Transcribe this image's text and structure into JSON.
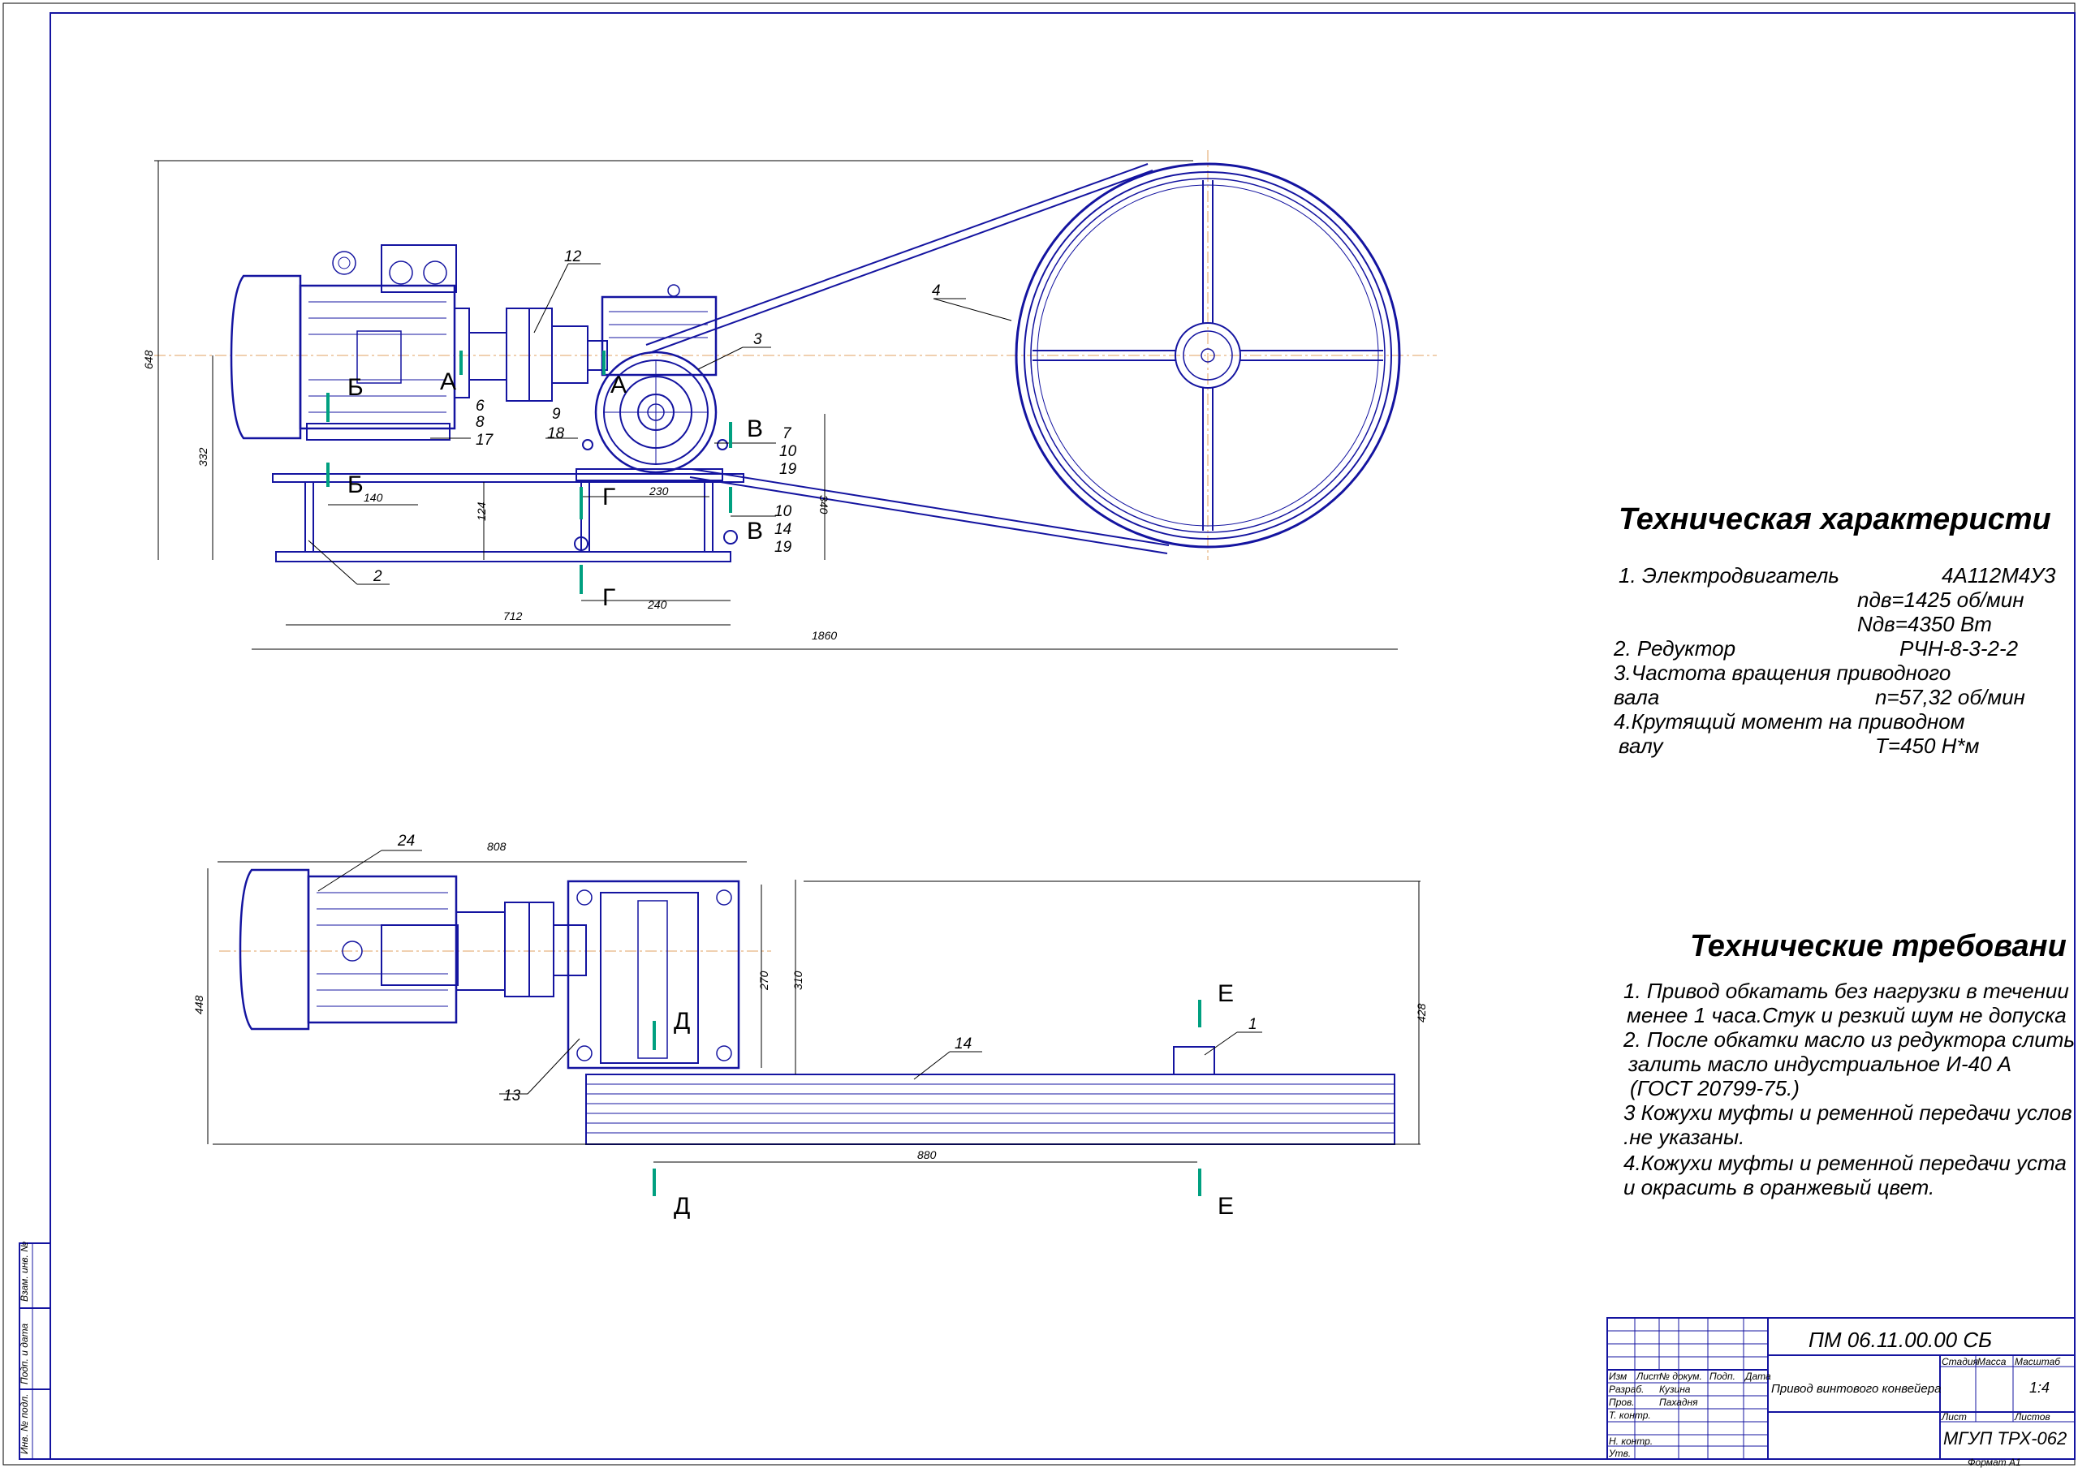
{
  "views": {
    "front": {
      "positions": [
        "12",
        "3",
        "4",
        "6",
        "8",
        "17",
        "9",
        "18",
        "7",
        "10",
        "19",
        "10",
        "14",
        "19",
        "2"
      ],
      "dims": [
        "648",
        "332",
        "124",
        "140",
        "230",
        "340",
        "712",
        "240",
        "1860"
      ],
      "sections": [
        "Б",
        "А",
        "А",
        "Б",
        "В",
        "Г",
        "В",
        "Г"
      ]
    },
    "top": {
      "positions": [
        "24",
        "13",
        "14",
        "1"
      ],
      "dims": [
        "808",
        "448",
        "270",
        "310",
        "428",
        "880"
      ],
      "sections": [
        "Д",
        "Е",
        "Д",
        "Е"
      ]
    }
  },
  "tech_characteristics": {
    "title": "Техническая характеристи",
    "lines": [
      "1. Электродвигатель",
      "4А112М4У3",
      "nдв=1425 об/мин",
      "Nдв=4350 Вт",
      "2. Редуктор",
      "РЧН-8-3-2-2",
      "3.Частота вращения приводного",
      "вала",
      "n=57,32 об/мин",
      "4.Крутящий момент на приводном",
      "валу",
      "Т=450 Н*м"
    ]
  },
  "tech_requirements": {
    "title": "Технические требовани",
    "lines": [
      "1. Привод обкатать без нагрузки в течении",
      "менее 1 часа.Стук и резкий шум не допуска",
      "2. После обкатки масло из редуктора слить",
      "залить масло индустриальное И-40 А",
      "(ГОСТ 20799-75.)",
      "3 Кожухи муфты и ременной передачи услов",
      ".не указаны.",
      "4.Кожухи муфты и ременной передачи уста",
      "и окрасить в оранжевый цвет."
    ]
  },
  "title_block": {
    "doc_code": "ПМ 06.11.00.00 СБ",
    "name": "Привод винтового конвейера",
    "headers": [
      "Изм",
      "Лист",
      "№ докум.",
      "Подп.",
      "Дата"
    ],
    "roles": [
      "Разраб.",
      "Пров.",
      "Т. контр.",
      "",
      "Н. контр.",
      "Утв."
    ],
    "people": [
      "Кузина",
      "Пахадня"
    ],
    "stage_label": "Стадия",
    "mass_label": "Масса",
    "scale_label": "Масштаб",
    "scale": "1:4",
    "sheet_label": "Лист",
    "sheets_label": "Листов",
    "org": "МГУП ТРХ-062",
    "format": "Формат  А1"
  },
  "side_stamp": [
    "Инв. № подл.",
    "Подп. и дата",
    "Взам. инв. №"
  ],
  "colors": {
    "outline": "#1414a0",
    "section_mark": "#00a080",
    "axis": "#e0a060"
  }
}
